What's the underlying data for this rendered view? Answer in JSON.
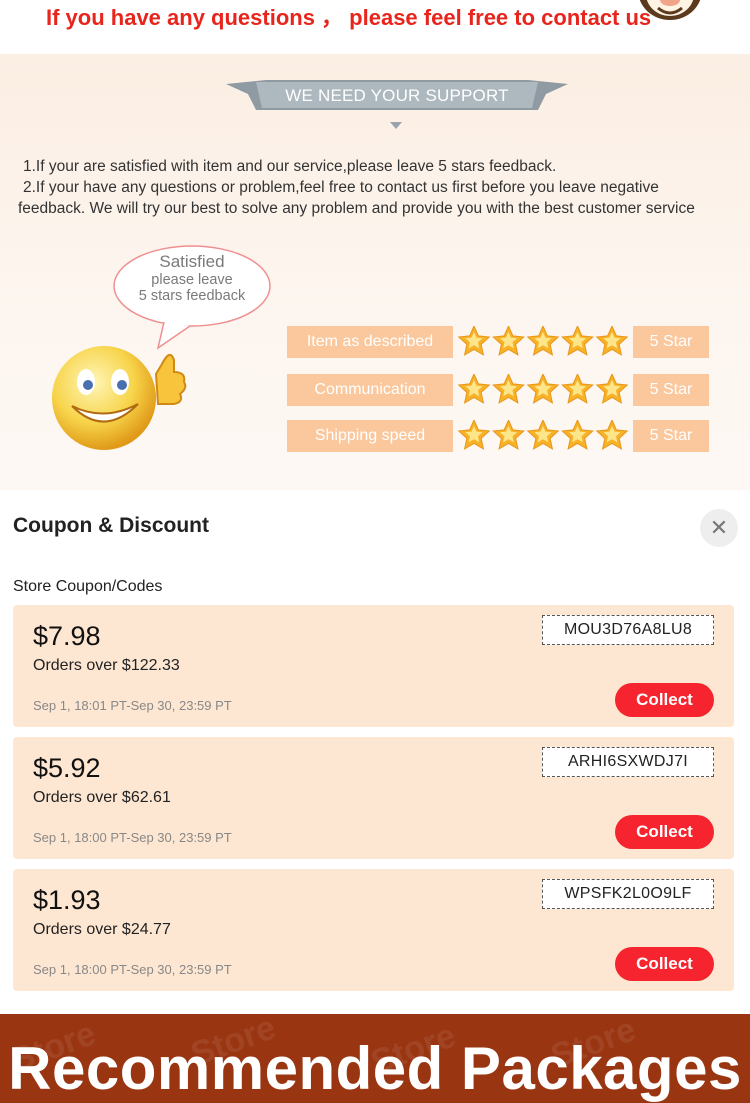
{
  "contact": {
    "text": "If you have any questions ， please feel free to contact us"
  },
  "support": {
    "banner": "WE NEED YOUR SUPPORT",
    "line1": "1.If your are satisfied with item and our service,please leave 5 stars feedback.",
    "line2": "2.If your have any questions or problem,feel free to contact us first before you leave negative",
    "line3": "feedback. We will try our best to solve any problem and provide you with the best customer service",
    "bubble": {
      "title": "Satisfied",
      "line1": "please leave",
      "line2": "5 stars feedback"
    },
    "ratings": [
      {
        "label": "Item as described",
        "stars": 5,
        "value": "5 Star"
      },
      {
        "label": "Communication",
        "stars": 5,
        "value": "5 Star"
      },
      {
        "label": "Shipping speed",
        "stars": 5,
        "value": "5 Star"
      }
    ]
  },
  "coupon": {
    "title": "Coupon & Discount",
    "close_icon": "close-icon",
    "subtitle": "Store Coupon/Codes",
    "cards": [
      {
        "amount": "$7.98",
        "condition": "Orders over $122.33",
        "date": "Sep 1, 18:01 PT-Sep 30, 23:59 PT",
        "code": "MOU3D76A8LU8",
        "action": "Collect"
      },
      {
        "amount": "$5.92",
        "condition": "Orders over $62.61",
        "date": "Sep 1, 18:00 PT-Sep 30, 23:59 PT",
        "code": "ARHI6SXWDJ7I",
        "action": "Collect"
      },
      {
        "amount": "$1.93",
        "condition": "Orders over $24.77",
        "date": "Sep 1, 18:00 PT-Sep 30, 23:59 PT",
        "code": "WPSFK2L0O9LF",
        "action": "Collect"
      }
    ]
  },
  "recommend": {
    "title": "Recommended Packages",
    "watermark": "Store"
  },
  "colors": {
    "contact_red": "#e8251c",
    "banner_grey": "#a9b2b9",
    "rating_orange": "#fbc89d",
    "star_gold": "#f7b227",
    "coupon_bg": "#fde7d2",
    "collect_red": "#f5242e",
    "recommend_bg": "#9a3512"
  }
}
